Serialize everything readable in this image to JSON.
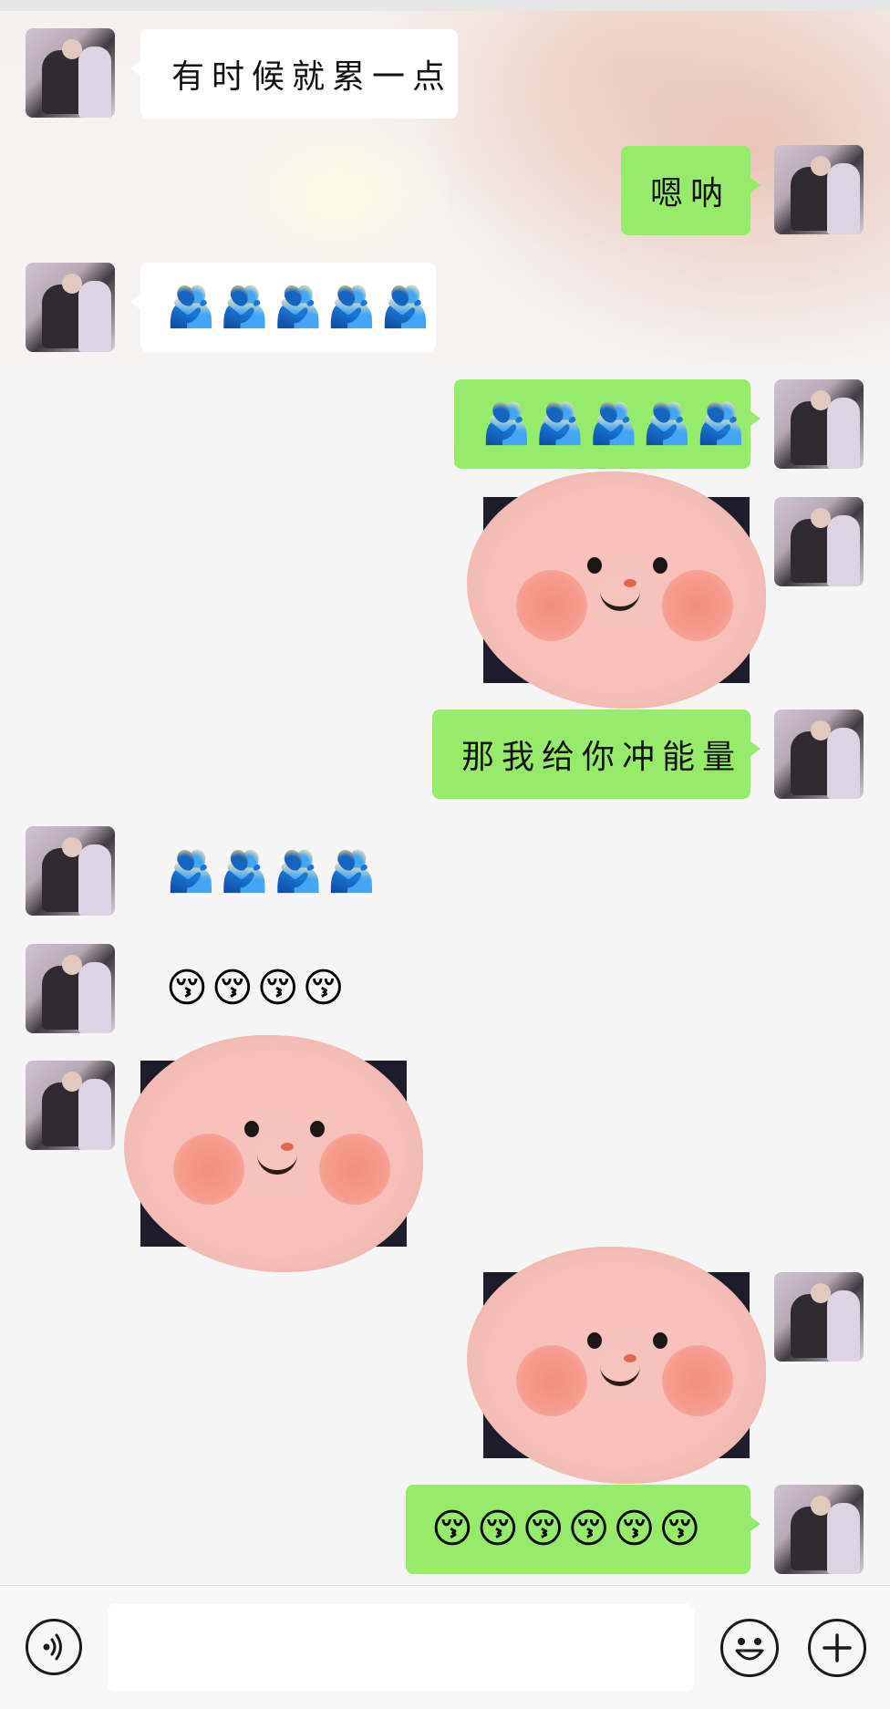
{
  "messages": [
    {
      "side": "in",
      "type": "text",
      "text": "有时候就累一点"
    },
    {
      "side": "out",
      "type": "text",
      "text": "嗯呐"
    },
    {
      "side": "in",
      "type": "emoji",
      "text": "🫂🫂🫂🫂🫂",
      "emoji_name": "people-hugging"
    },
    {
      "side": "out",
      "type": "emoji",
      "text": "🫂🫂🫂🫂🫂",
      "emoji_name": "people-hugging"
    },
    {
      "side": "out",
      "type": "sticker",
      "sticker_name": "pink-blush-face"
    },
    {
      "side": "out",
      "type": "text",
      "text": "那我给你冲能量"
    },
    {
      "side": "in",
      "type": "emoji",
      "text": "🫂🫂🫂🫂",
      "emoji_name": "people-hugging"
    },
    {
      "side": "in",
      "type": "emoji",
      "text": "😚😚😚😚",
      "emoji_name": "kissing-face"
    },
    {
      "side": "in",
      "type": "sticker",
      "sticker_name": "pink-blush-face"
    },
    {
      "side": "out",
      "type": "sticker",
      "sticker_name": "pink-blush-face"
    },
    {
      "side": "out",
      "type": "emoji",
      "text": "😚😚😚😚😚😚",
      "emoji_name": "kissing-face"
    }
  ],
  "input_bar": {
    "voice_icon": "voice-icon",
    "input_value": "",
    "emoji_icon": "smiley-icon",
    "more_icon": "plus-icon"
  },
  "colors": {
    "outgoing_bubble": "#95ec69",
    "incoming_bubble": "#ffffff",
    "wallpaper_accent": "#e9beaf"
  }
}
